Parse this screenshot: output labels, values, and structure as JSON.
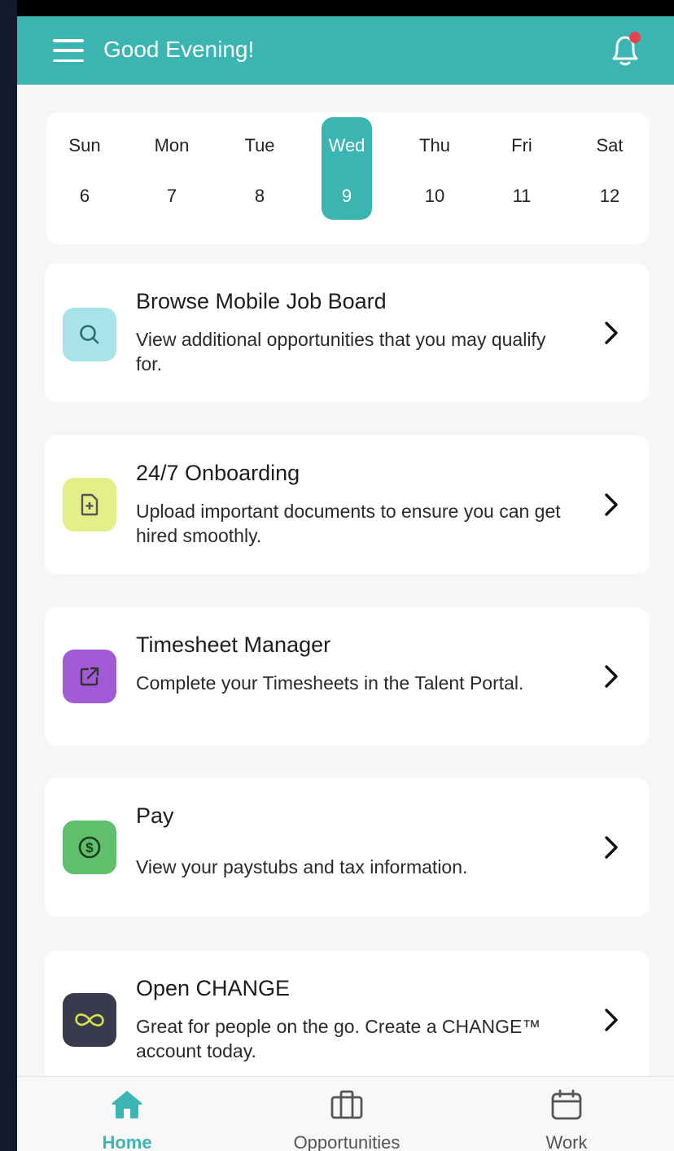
{
  "header": {
    "greeting": "Good Evening!",
    "accent_color": "#3bb5b2",
    "menu_icon": "hamburger-menu-icon",
    "notification_icon": "bell-icon",
    "notification_dot_color": "#e8424f"
  },
  "calendar": {
    "days": [
      {
        "name": "Sun",
        "num": "6"
      },
      {
        "name": "Mon",
        "num": "7"
      },
      {
        "name": "Tue",
        "num": "8"
      },
      {
        "name": "Wed",
        "num": "9"
      },
      {
        "name": "Thu",
        "num": "10"
      },
      {
        "name": "Fri",
        "num": "11"
      },
      {
        "name": "Sat",
        "num": "12"
      }
    ],
    "selected": "Wed"
  },
  "cards": [
    {
      "title": "Browse Mobile Job Board",
      "desc": "View additional opportunities that you may qualify for.",
      "icon": "search-icon",
      "icon_bg": "#a9e3ea"
    },
    {
      "title": "24/7 Onboarding",
      "desc": "Upload important documents to ensure you can get hired smoothly.",
      "icon": "document-add-icon",
      "icon_bg": "#e4ef8a"
    },
    {
      "title": "Timesheet Manager",
      "desc": "Complete your Timesheets in the Talent Portal.",
      "icon": "external-link-icon",
      "icon_bg": "#a25ad9"
    },
    {
      "title": "Pay",
      "desc": "View your paystubs and tax information.",
      "icon": "dollar-coin-icon",
      "icon_bg": "#5fbf6a"
    },
    {
      "title": "Open CHANGE",
      "desc": "Great for people on the go. Create a CHANGE™ account today.",
      "icon": "infinity-icon",
      "icon_bg": "#3a3a4e"
    }
  ],
  "nav": {
    "items": [
      {
        "label": "Home",
        "icon": "home-icon",
        "active": true
      },
      {
        "label": "Opportunities",
        "icon": "briefcase-icon",
        "active": false
      },
      {
        "label": "Work",
        "icon": "calendar-icon",
        "active": false
      }
    ]
  }
}
